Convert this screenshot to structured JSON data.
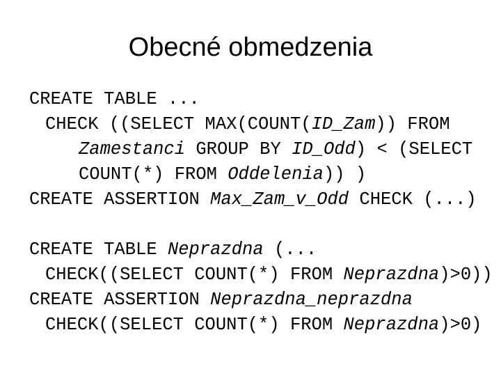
{
  "slide": {
    "title": "Obecné obmedzenia",
    "background_color": "#ffffff",
    "text_color": "#000000",
    "blocks": [
      {
        "name": "assertion-max-zam-v-odd",
        "lines": [
          {
            "indent": 0,
            "segments": [
              {
                "text": "CREATE TABLE ...",
                "italic": false
              }
            ]
          },
          {
            "indent": 1,
            "segments": [
              {
                "text": "CHECK ((SELECT MAX(COUNT(",
                "italic": false
              },
              {
                "text": "ID_Zam",
                "italic": true
              },
              {
                "text": ")) FROM",
                "italic": false
              }
            ]
          },
          {
            "indent": 2,
            "segments": [
              {
                "text": "Zamestanci",
                "italic": true
              },
              {
                "text": " GROUP BY ",
                "italic": false
              },
              {
                "text": "ID_Odd",
                "italic": true
              },
              {
                "text": ") < (SELECT",
                "italic": false
              }
            ]
          },
          {
            "indent": 2,
            "segments": [
              {
                "text": "COUNT(*) FROM ",
                "italic": false
              },
              {
                "text": "Oddelenia",
                "italic": true
              },
              {
                "text": ")) )",
                "italic": false
              }
            ]
          },
          {
            "indent": 0,
            "segments": [
              {
                "text": "CREATE ASSERTION ",
                "italic": false
              },
              {
                "text": "Max_Zam_v_Odd",
                "italic": true
              },
              {
                "text": " CHECK (...)",
                "italic": false
              }
            ]
          }
        ]
      },
      {
        "name": "assertion-neprazdna",
        "lines": [
          {
            "indent": 0,
            "segments": [
              {
                "text": "CREATE TABLE ",
                "italic": false
              },
              {
                "text": "Neprazdna",
                "italic": true
              },
              {
                "text": " (...",
                "italic": false
              }
            ]
          },
          {
            "indent": 1,
            "segments": [
              {
                "text": "CHECK((SELECT COUNT(*) FROM ",
                "italic": false
              },
              {
                "text": "Neprazdna",
                "italic": true
              },
              {
                "text": ")>0))",
                "italic": false
              }
            ]
          },
          {
            "indent": 0,
            "segments": [
              {
                "text": "CREATE ASSERTION ",
                "italic": false
              },
              {
                "text": "Neprazdna_neprazdna",
                "italic": true
              }
            ]
          },
          {
            "indent": 1,
            "segments": [
              {
                "text": "CHECK((SELECT COUNT(*) FROM ",
                "italic": false
              },
              {
                "text": "Neprazdna",
                "italic": true
              },
              {
                "text": ")>0)",
                "italic": false
              }
            ]
          }
        ]
      }
    ]
  }
}
